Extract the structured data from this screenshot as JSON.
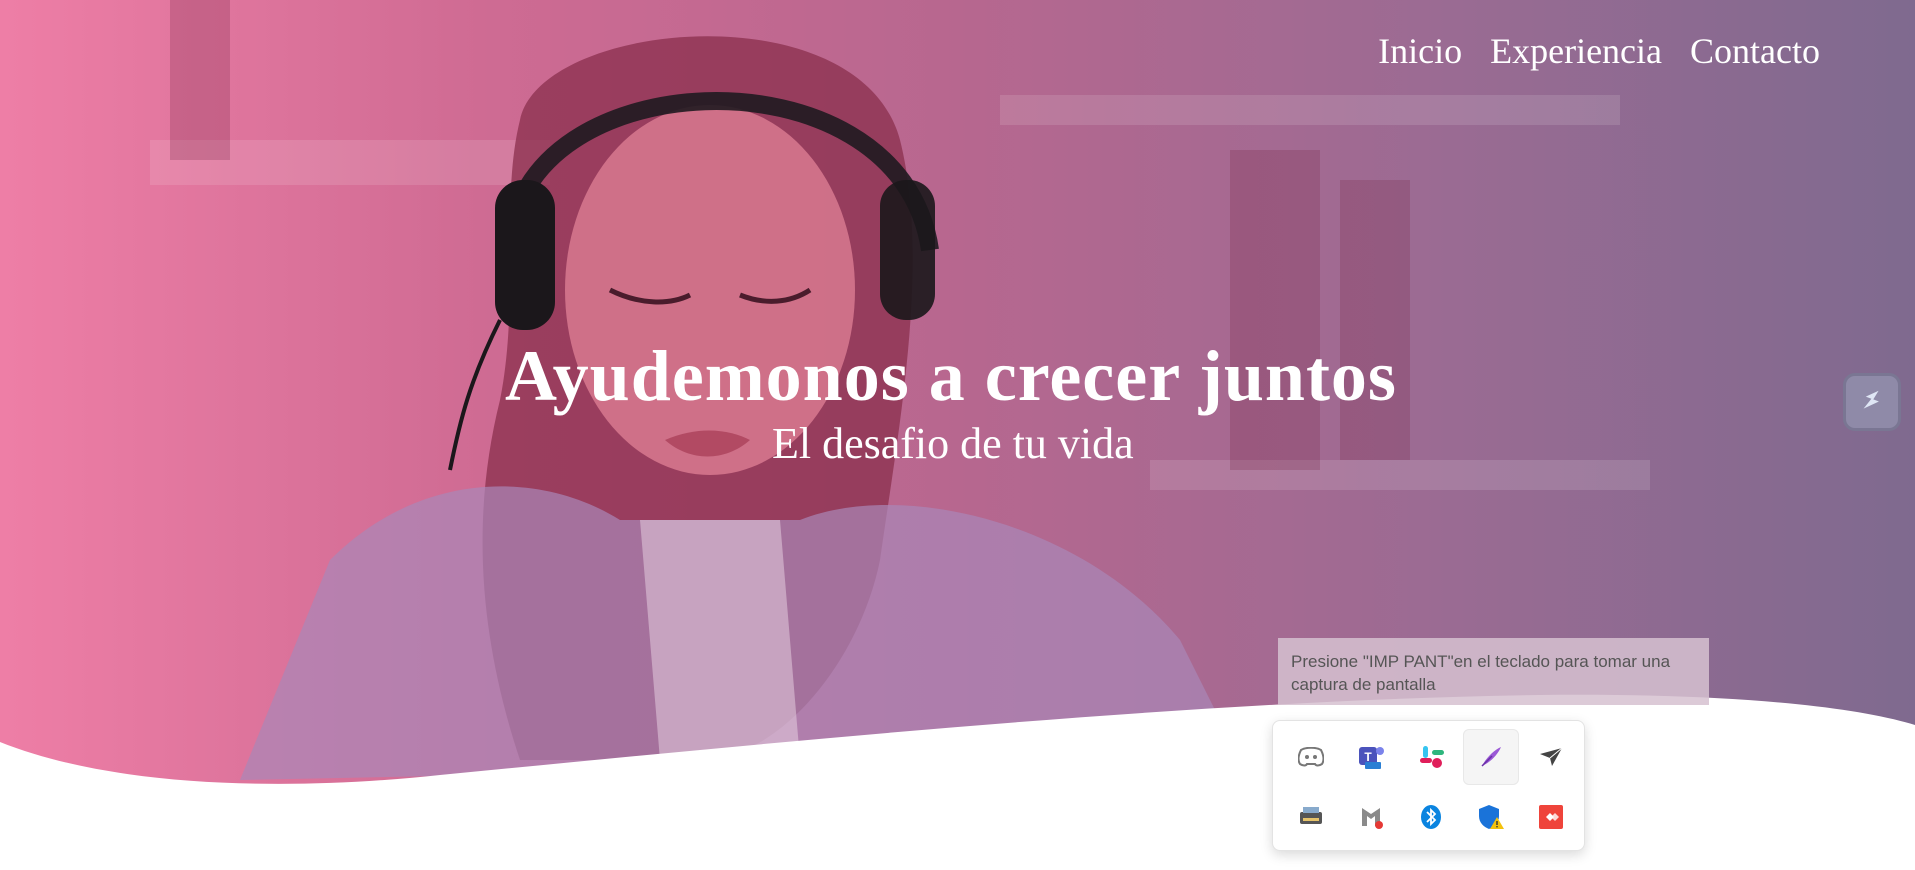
{
  "nav": {
    "items": [
      {
        "label": "Inicio"
      },
      {
        "label": "Experiencia"
      },
      {
        "label": "Contacto"
      }
    ]
  },
  "hero": {
    "title": "Ayudemonos a crecer juntos",
    "subtitle": "El desafio de tu vida"
  },
  "colors": {
    "overlay_left": "#ee7ea6",
    "overlay_right": "#7f6a8f",
    "text": "#ffffff"
  },
  "side_button": {
    "icon": "snip-tool-icon"
  },
  "tooltip": {
    "text": "Presione \"IMP PANT\"en el teclado para tomar una captura de pantalla"
  },
  "tray": {
    "icons": [
      {
        "name": "discord-icon"
      },
      {
        "name": "teams-new-icon"
      },
      {
        "name": "slack-icon"
      },
      {
        "name": "pen-feather-icon"
      },
      {
        "name": "paper-plane-icon"
      },
      {
        "name": "scanner-icon"
      },
      {
        "name": "mcafee-icon"
      },
      {
        "name": "bluetooth-icon"
      },
      {
        "name": "security-shield-warning-icon"
      },
      {
        "name": "anydesk-icon"
      }
    ]
  }
}
